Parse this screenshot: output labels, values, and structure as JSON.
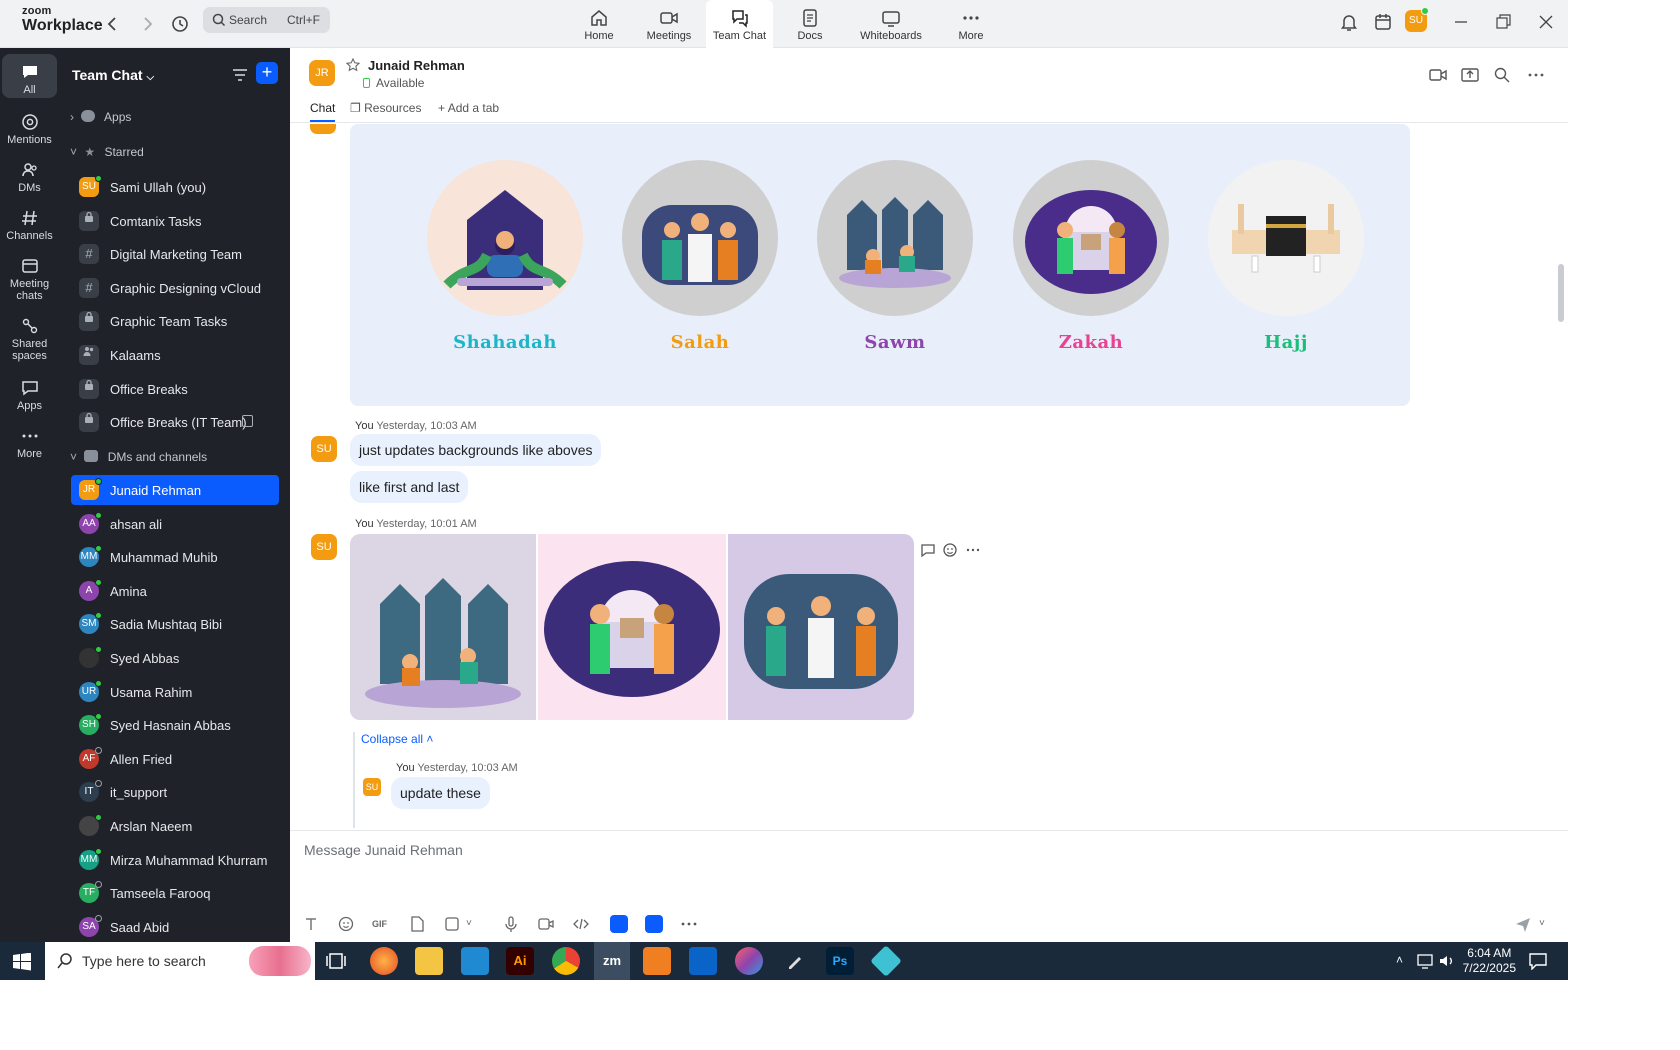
{
  "app": {
    "logo_line1": "zoom",
    "logo_line2": "Workplace",
    "search_placeholder": "Search",
    "search_shortcut": "Ctrl+F",
    "user_initials": "SU"
  },
  "nav_tabs": [
    {
      "label": "Home",
      "icon": "home-icon"
    },
    {
      "label": "Meetings",
      "icon": "video-icon"
    },
    {
      "label": "Team Chat",
      "icon": "chat-icon"
    },
    {
      "label": "Docs",
      "icon": "doc-icon"
    },
    {
      "label": "Whiteboards",
      "icon": "whiteboard-icon"
    },
    {
      "label": "More",
      "icon": "more-icon"
    }
  ],
  "rail": [
    {
      "label": "All"
    },
    {
      "label": "Mentions"
    },
    {
      "label": "DMs"
    },
    {
      "label": "Channels"
    },
    {
      "label": "Meeting\nchats"
    },
    {
      "label": "Shared\nspaces"
    },
    {
      "label": "Apps"
    },
    {
      "label": "More"
    }
  ],
  "sidebar": {
    "title": "Team Chat",
    "apps_label": "Apps",
    "starred_label": "Starred",
    "dms_label": "DMs and channels",
    "starred": [
      {
        "label": "Sami Ullah (you)",
        "initials": "SU",
        "color": "#f39c12"
      },
      {
        "label": "Comtanix Tasks",
        "icon": "lock-icon"
      },
      {
        "label": "Digital Marketing Team",
        "icon": "hash-icon"
      },
      {
        "label": "Graphic Designing vCloud",
        "icon": "hash-icon"
      },
      {
        "label": "Graphic Team Tasks",
        "icon": "lock-icon"
      },
      {
        "label": "Kalaams",
        "icon": "group-icon"
      },
      {
        "label": "Office Breaks",
        "icon": "lock-icon"
      },
      {
        "label": "Office Breaks (IT Team)",
        "icon": "lock-icon"
      }
    ],
    "dms": [
      {
        "label": "Junaid Rehman",
        "initials": "JR",
        "color": "#f39c12",
        "active": true
      },
      {
        "label": "ahsan ali",
        "initials": "AA",
        "color": "#8e44ad"
      },
      {
        "label": "Muhammad Muhib",
        "initials": "MM",
        "color": "#2e86c1"
      },
      {
        "label": "Amina",
        "initials": "A",
        "color": "#8e44ad"
      },
      {
        "label": "Sadia Mushtaq Bibi",
        "initials": "SM",
        "color": "#2e86c1"
      },
      {
        "label": "Syed Abbas",
        "initials": "",
        "color": "#333333"
      },
      {
        "label": "Usama Rahim",
        "initials": "UR",
        "color": "#2e86c1"
      },
      {
        "label": "Syed Hasnain Abbas",
        "initials": "SH",
        "color": "#27ae60"
      },
      {
        "label": "Allen Fried",
        "initials": "AF",
        "color": "#c0392b"
      },
      {
        "label": "it_support",
        "initials": "IT",
        "color": "#2c3e50"
      },
      {
        "label": "Arslan Naeem",
        "initials": "",
        "color": "#444444"
      },
      {
        "label": "Mirza Muhammad Khurram",
        "initials": "MM",
        "color": "#16a085"
      },
      {
        "label": "Tamseela Farooq",
        "initials": "TF",
        "color": "#27ae60"
      },
      {
        "label": "Saad Abid",
        "initials": "SA",
        "color": "#8e44ad"
      }
    ]
  },
  "chat": {
    "contact_initials": "JR",
    "contact_name": "Junaid Rehman",
    "status": "Available",
    "tabs": [
      "Chat",
      "Resources",
      "Add a tab"
    ],
    "pillars": [
      {
        "label": "Shahadah",
        "color": "#1fb5c9"
      },
      {
        "label": "Salah",
        "color": "#f39c12"
      },
      {
        "label": "Sawm",
        "color": "#8e44ad"
      },
      {
        "label": "Zakah",
        "color": "#e84393"
      },
      {
        "label": "Hajj",
        "color": "#1bbf7a"
      }
    ],
    "msg1": {
      "sender": "You",
      "time": "Yesterday, 10:03 AM",
      "initials": "SU",
      "lines": [
        "just updates backgrounds like aboves",
        "like first and last"
      ]
    },
    "msg2": {
      "sender": "You",
      "time": "Yesterday, 10:01 AM",
      "initials": "SU"
    },
    "collapse_label": "Collapse all",
    "reply": {
      "sender": "You",
      "time": "Yesterday, 10:03 AM",
      "initials": "SU",
      "text": "update these"
    },
    "composer_placeholder": "Message Junaid Rehman"
  },
  "taskbar": {
    "search_placeholder": "Type here to search",
    "time": "6:04 AM",
    "date": "7/22/2025"
  }
}
